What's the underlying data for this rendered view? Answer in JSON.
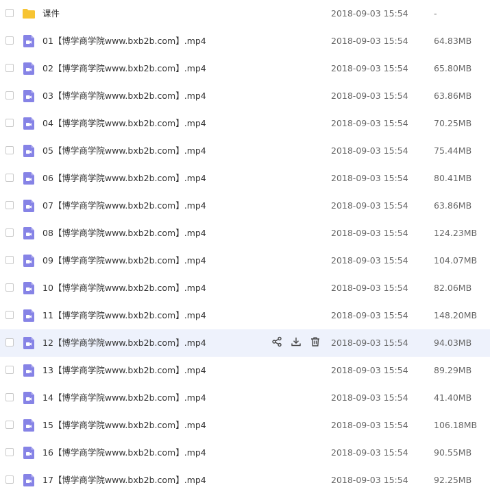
{
  "colors": {
    "folder": "#f7c433",
    "video": "#8683e6",
    "hover_row": "#eef2fc"
  },
  "files": [
    {
      "name": "课件",
      "type": "folder",
      "date": "2018-09-03 15:54",
      "size": "-"
    },
    {
      "name": "01【博学商学院www.bxb2b.com】.mp4",
      "type": "video",
      "date": "2018-09-03 15:54",
      "size": "64.83MB"
    },
    {
      "name": "02【博学商学院www.bxb2b.com】.mp4",
      "type": "video",
      "date": "2018-09-03 15:54",
      "size": "65.80MB"
    },
    {
      "name": "03【博学商学院www.bxb2b.com】.mp4",
      "type": "video",
      "date": "2018-09-03 15:54",
      "size": "63.86MB"
    },
    {
      "name": "04【博学商学院www.bxb2b.com】.mp4",
      "type": "video",
      "date": "2018-09-03 15:54",
      "size": "70.25MB"
    },
    {
      "name": "05【博学商学院www.bxb2b.com】.mp4",
      "type": "video",
      "date": "2018-09-03 15:54",
      "size": "75.44MB"
    },
    {
      "name": "06【博学商学院www.bxb2b.com】.mp4",
      "type": "video",
      "date": "2018-09-03 15:54",
      "size": "80.41MB"
    },
    {
      "name": "07【博学商学院www.bxb2b.com】.mp4",
      "type": "video",
      "date": "2018-09-03 15:54",
      "size": "63.86MB"
    },
    {
      "name": "08【博学商学院www.bxb2b.com】.mp4",
      "type": "video",
      "date": "2018-09-03 15:54",
      "size": "124.23MB"
    },
    {
      "name": "09【博学商学院www.bxb2b.com】.mp4",
      "type": "video",
      "date": "2018-09-03 15:54",
      "size": "104.07MB"
    },
    {
      "name": "10【博学商学院www.bxb2b.com】.mp4",
      "type": "video",
      "date": "2018-09-03 15:54",
      "size": "82.06MB"
    },
    {
      "name": "11【博学商学院www.bxb2b.com】.mp4",
      "type": "video",
      "date": "2018-09-03 15:54",
      "size": "148.20MB"
    },
    {
      "name": "12【博学商学院www.bxb2b.com】.mp4",
      "type": "video",
      "date": "2018-09-03 15:54",
      "size": "94.03MB",
      "hover": true
    },
    {
      "name": "13【博学商学院www.bxb2b.com】.mp4",
      "type": "video",
      "date": "2018-09-03 15:54",
      "size": "89.29MB"
    },
    {
      "name": "14【博学商学院www.bxb2b.com】.mp4",
      "type": "video",
      "date": "2018-09-03 15:54",
      "size": "41.40MB"
    },
    {
      "name": "15【博学商学院www.bxb2b.com】.mp4",
      "type": "video",
      "date": "2018-09-03 15:54",
      "size": "106.18MB"
    },
    {
      "name": "16【博学商学院www.bxb2b.com】.mp4",
      "type": "video",
      "date": "2018-09-03 15:54",
      "size": "90.55MB"
    },
    {
      "name": "17【博学商学院www.bxb2b.com】.mp4",
      "type": "video",
      "date": "2018-09-03 15:54",
      "size": "92.25MB"
    }
  ],
  "row_actions": [
    {
      "icon": "share-icon"
    },
    {
      "icon": "download-icon"
    },
    {
      "icon": "delete-icon"
    }
  ]
}
